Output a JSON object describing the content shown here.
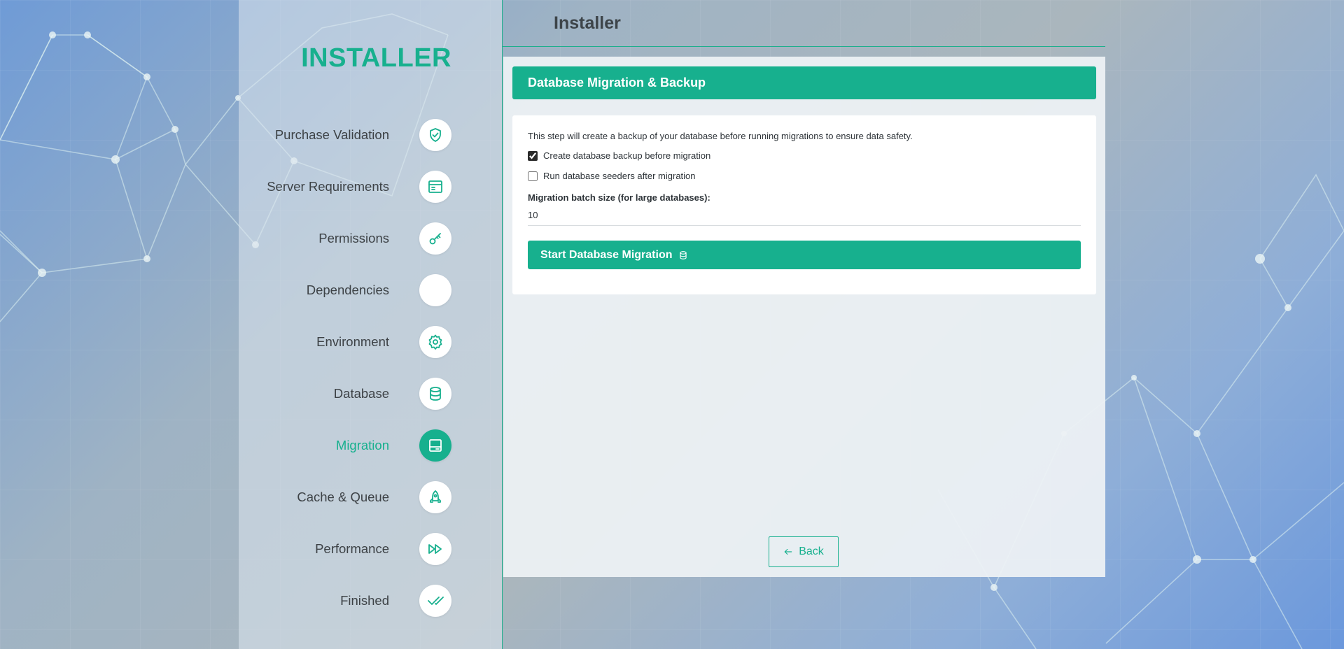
{
  "header": {
    "title": "Installer"
  },
  "sidebar": {
    "brand": "INSTALLER",
    "steps": [
      {
        "label": "Purchase Validation",
        "icon": "shield-check-icon",
        "active": false
      },
      {
        "label": "Server Requirements",
        "icon": "server-window-icon",
        "active": false
      },
      {
        "label": "Permissions",
        "icon": "key-icon",
        "active": false
      },
      {
        "label": "Dependencies",
        "icon": "blank-icon",
        "active": false
      },
      {
        "label": "Environment",
        "icon": "gear-icon",
        "active": false
      },
      {
        "label": "Database",
        "icon": "database-icon",
        "active": false
      },
      {
        "label": "Migration",
        "icon": "migration-icon",
        "active": true
      },
      {
        "label": "Cache & Queue",
        "icon": "rocket-icon",
        "active": false
      },
      {
        "label": "Performance",
        "icon": "fast-forward-icon",
        "active": false
      },
      {
        "label": "Finished",
        "icon": "double-check-icon",
        "active": false
      }
    ]
  },
  "main": {
    "section_title": "Database Migration & Backup",
    "description": "This step will create a backup of your database before running migrations to ensure data safety.",
    "options": [
      {
        "label": "Create database backup before migration",
        "checked": true
      },
      {
        "label": "Run database seeders after migration",
        "checked": false
      }
    ],
    "batch_size": {
      "label": "Migration batch size (for large databases):",
      "value": "10"
    },
    "start_button": "Start Database Migration",
    "back_button": "Back"
  },
  "colors": {
    "accent": "#17b08e",
    "text": "#3d4246"
  }
}
